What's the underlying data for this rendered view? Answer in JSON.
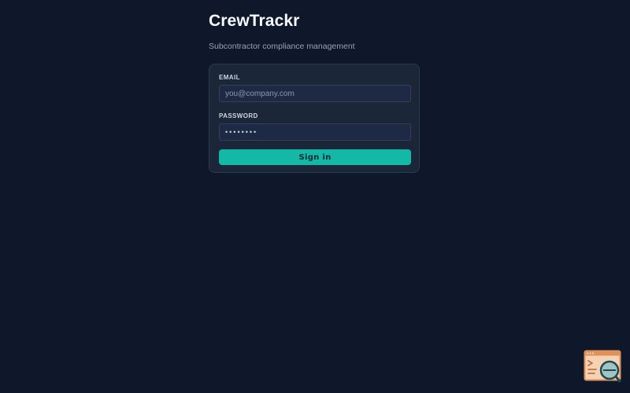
{
  "app": {
    "title": "CrewTrackr",
    "subtitle": "Subcontractor compliance management"
  },
  "login_form": {
    "email_label": "EMAIL",
    "email_placeholder": "you@company.com",
    "email_value": "",
    "password_label": "PASSWORD",
    "password_value": "••••••••",
    "submit_label": "Sign in"
  },
  "colors": {
    "background": "#0f172a",
    "card": "#1b2639",
    "accent": "#14b8a6",
    "widget_accent": "#e0915a"
  },
  "icons": {
    "corner_widget": "terminal-search-icon"
  }
}
